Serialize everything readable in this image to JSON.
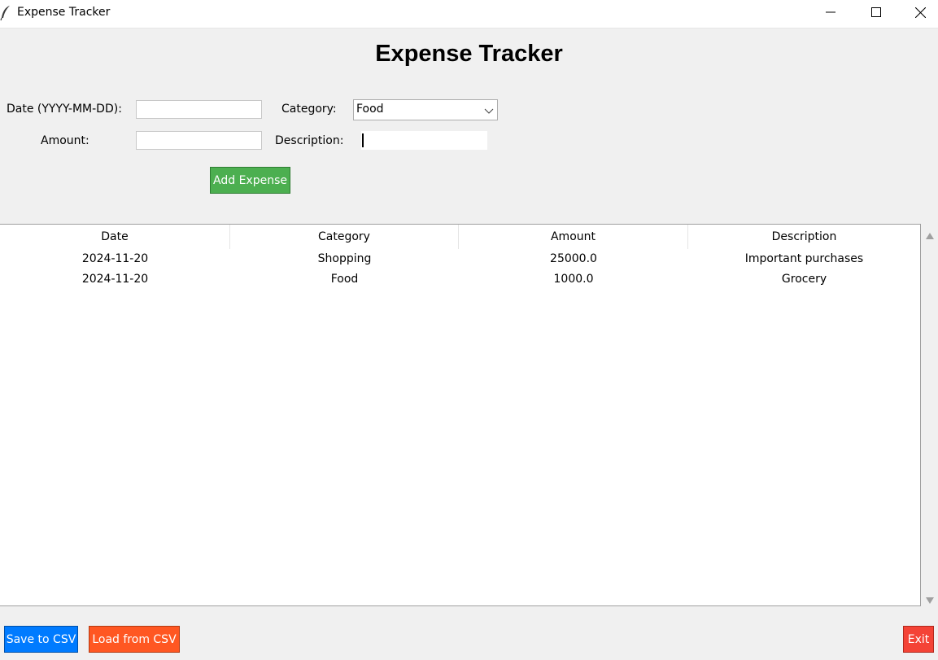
{
  "window": {
    "title": "Expense Tracker",
    "icon": "feather-icon",
    "controls": [
      "minimize-icon",
      "maximize-icon",
      "close-icon"
    ]
  },
  "heading": "Expense Tracker",
  "form": {
    "date_label": "Date (YYYY-MM-DD):",
    "date_value": "",
    "category_label": "Category:",
    "category_value": "Food",
    "amount_label": "Amount:",
    "amount_value": "",
    "description_label": "Description:",
    "description_value": "",
    "add_button": "Add Expense"
  },
  "table": {
    "columns": [
      "Date",
      "Category",
      "Amount",
      "Description"
    ],
    "rows": [
      [
        "2024-11-20",
        "Shopping",
        "25000.0",
        "Important purchases"
      ],
      [
        "2024-11-20",
        "Food",
        "1000.0",
        "Grocery"
      ]
    ]
  },
  "buttons": {
    "save": "Save to CSV",
    "load": "Load from CSV",
    "exit": "Exit"
  },
  "colors": {
    "add_button": "#4caf50",
    "save_button": "#007bff",
    "load_button": "#ff5722",
    "exit_button": "#f44336"
  }
}
